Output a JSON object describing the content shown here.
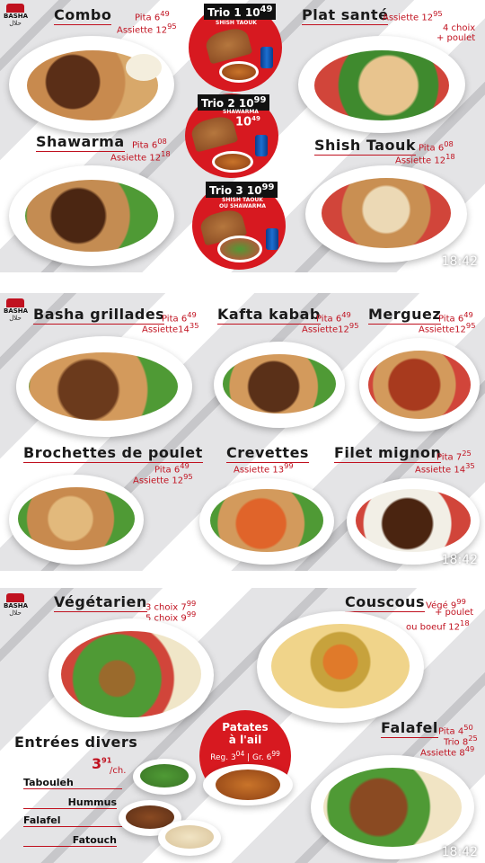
{
  "board1": {
    "combo": {
      "title": "Combo",
      "pita": "Pita 6",
      "pita_sup": "49",
      "assiette": "Assiette 12",
      "assiette_sup": "95"
    },
    "plat_sante": {
      "title": "Plat santé",
      "assiette": "Assiette 12",
      "assiette_sup": "95",
      "note1": "4 choix",
      "note2": "+ poulet"
    },
    "shawarma": {
      "title": "Shawarma",
      "pita": "Pita 6",
      "pita_sup": "08",
      "assiette": "Assiette 12",
      "assiette_sup": "18"
    },
    "shish_taouk": {
      "title": "Shish Taouk",
      "pita": "Pita 6",
      "pita_sup": "08",
      "assiette": "Assiette 12",
      "assiette_sup": "18"
    },
    "trio1": {
      "label": "Trio 1 10",
      "sup": "49",
      "sub": "SHISH TAOUK"
    },
    "trio2": {
      "label": "Trio 2 10",
      "sup": "99",
      "sub": "SHAWARMA",
      "price": "10",
      "price_sup": "49"
    },
    "trio3": {
      "label": "Trio 3 10",
      "sup": "99",
      "sub1": "SHISH TAOUK",
      "sub2": "OU SHAWARMA"
    },
    "time": "18:42"
  },
  "board2": {
    "grillades": {
      "title": "Basha grillades",
      "pita": "Pita 6",
      "pita_sup": "49",
      "assiette": "Assiette14",
      "assiette_sup": "35"
    },
    "kafta": {
      "title": "Kafta kabab",
      "pita": "Pita 6",
      "pita_sup": "49",
      "assiette": "Assiette12",
      "assiette_sup": "95"
    },
    "merguez": {
      "title": "Merguez",
      "pita": "Pita 6",
      "pita_sup": "49",
      "assiette": "Assiette12",
      "assiette_sup": "95"
    },
    "brochettes": {
      "title": "Brochettes de poulet",
      "pita": "Pita 6",
      "pita_sup": "49",
      "assiette": "Assiette 12",
      "assiette_sup": "95"
    },
    "crevettes": {
      "title": "Crevettes",
      "assiette": "Assiette 13",
      "assiette_sup": "99"
    },
    "filet": {
      "title": "Filet mignon",
      "pita": "Pita 7",
      "pita_sup": "25",
      "assiette": "Assiette 14",
      "assiette_sup": "35"
    },
    "time": "18:42"
  },
  "board3": {
    "vegetarien": {
      "title": "Végétarien",
      "line1": "3 choix 7",
      "line1_sup": "99",
      "line2": "5 choix 9",
      "line2_sup": "99"
    },
    "couscous": {
      "title": "Couscous",
      "vege": "Végé 9",
      "vege_sup": "99",
      "line2": "+ poulet",
      "line3": "ou boeuf 12",
      "line3_sup": "18"
    },
    "patates": {
      "title1": "Patates",
      "title2": "à l'ail",
      "reg": "Reg. 3",
      "reg_sup": "04",
      "sep": "|",
      "gr": "Gr. 6",
      "gr_sup": "99"
    },
    "entrees": {
      "title": "Entrées divers",
      "price": "3",
      "price_sup": "91",
      "unit": "/ch.",
      "items": [
        "Tabouleh",
        "Hummus",
        "Falafel",
        "Fatouch"
      ]
    },
    "falafel": {
      "title": "Falafel",
      "pita": "Pita 4",
      "pita_sup": "50",
      "trio": "Trio 8",
      "trio_sup": "25",
      "assiette": "Assiette 8",
      "assiette_sup": "49"
    },
    "time": "18:42"
  },
  "brand": {
    "name": "BASHA",
    "arabic": "حلال"
  },
  "colors": {
    "accent": "#c0111f",
    "circle": "#d71920"
  }
}
